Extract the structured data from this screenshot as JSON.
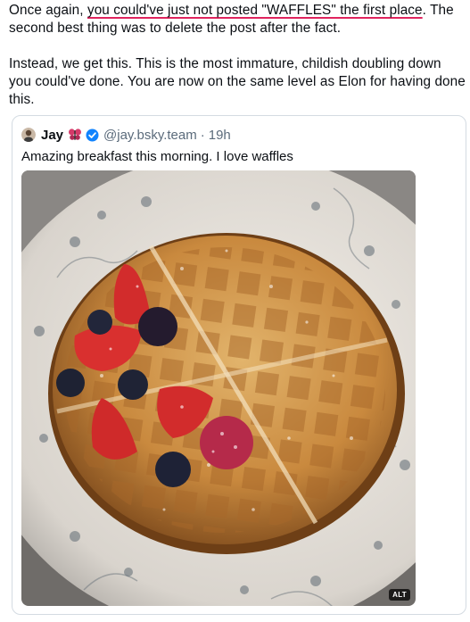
{
  "post": {
    "lead": "Once again, ",
    "underlined": "you could've just not posted \"WAFFLES\" the first place",
    "rest": ". The second best thing was to delete the post after the fact.",
    "paragraph2": "Instead, we get this. This is the most immature, childish doubling down you could've done. You are now on the same level as Elon for having done this."
  },
  "quote": {
    "author_name": "Jay",
    "handle": "@jay.bsky.team",
    "separator": "·",
    "time": "19h",
    "text": "Amazing breakfast this morning. I love waffles",
    "alt_label": "ALT",
    "emoji_icon": "butterfly-icon",
    "verified_color": "#1083fe"
  }
}
